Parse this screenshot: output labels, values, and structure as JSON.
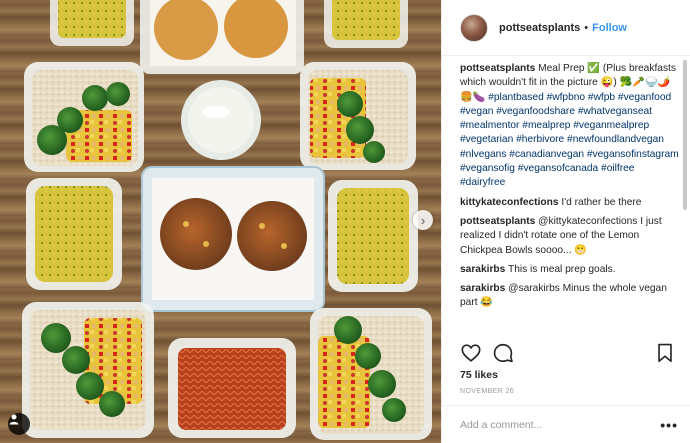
{
  "post": {
    "username": "pottseatsplants",
    "separator": "•",
    "follow_label": "Follow",
    "caption": {
      "username": "pottseatsplants",
      "text": "Meal Prep ✅ (Plus breakfasts which wouldn't fit in the picture 😜) 🥦🥕🍚🌶️🍔🍆",
      "hashtags": "#plantbased #wfpbno #wfpb #veganfood #vegan #veganfoodshare #whatveganseat #mealmentor #mealprep #veganmealprep #vegetarian #herbivore #newfoundlandvegan #nlvegans #canadianvegan #vegansofinstagram #vegansofig #vegansofcanada #oilfree #dairyfree"
    },
    "comments": [
      {
        "username": "kittykateconfections",
        "text": "I'd rather be there"
      },
      {
        "username": "pottseatsplants",
        "text": "@kittykateconfections I just realized I didn't rotate one of the Lemon Chickpea Bowls soooo... 😬"
      },
      {
        "username": "sarakirbs",
        "text": "This is meal prep goals."
      },
      {
        "username": "sarakirbs",
        "text": "@sarakirbs Minus the whole vegan part 😂"
      }
    ],
    "likes": "75 likes",
    "date": "NOVEMBER 26",
    "add_comment_placeholder": "Add a comment...",
    "more_label": "•••",
    "carousel_next": "›"
  },
  "icons": {
    "like": "heart-icon",
    "comment": "comment-icon",
    "save": "bookmark-icon",
    "more": "more-options-icon",
    "tagged": "person-tag-icon",
    "carousel": "chevron-right-icon"
  },
  "colors": {
    "link": "#3897f0",
    "hashtag": "#003569",
    "text": "#262626",
    "muted": "#999999"
  }
}
